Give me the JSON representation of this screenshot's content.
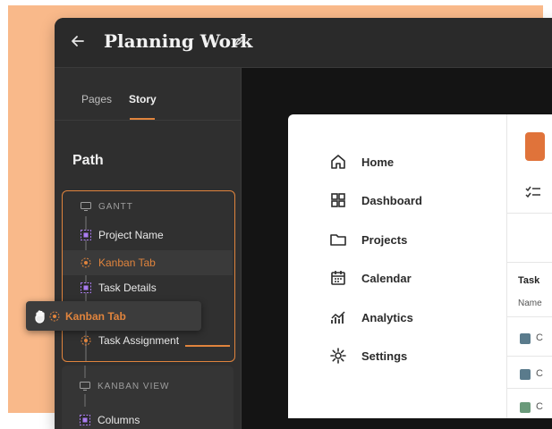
{
  "header": {
    "title": "Planning Work"
  },
  "sidebar": {
    "tabs": [
      {
        "label": "Pages"
      },
      {
        "label": "Story"
      }
    ],
    "path_title": "Path",
    "group1": {
      "header": "GANTT",
      "rows": [
        {
          "label": "Project Name"
        },
        {
          "label": "Kanban Tab"
        },
        {
          "label": "Task Details"
        },
        {
          "label": "Task Assignment"
        }
      ]
    },
    "group2": {
      "header": "KANBAN VIEW",
      "rows": [
        {
          "label": "Columns"
        }
      ]
    }
  },
  "drag_tooltip": {
    "label": "Kanban Tab"
  },
  "nav": {
    "items": [
      {
        "label": "Home",
        "icon": "home-icon"
      },
      {
        "label": "Dashboard",
        "icon": "dashboard-icon"
      },
      {
        "label": "Projects",
        "icon": "folder-icon"
      },
      {
        "label": "Calendar",
        "icon": "calendar-icon"
      },
      {
        "label": "Analytics",
        "icon": "analytics-icon"
      },
      {
        "label": "Settings",
        "icon": "settings-icon"
      }
    ]
  },
  "panel": {
    "task_header": "Task",
    "name_label": "Name",
    "row_marks": [
      "C",
      "C",
      "C"
    ],
    "colors": {
      "accent": "#e0843d",
      "swatch_blue": "#5a7b8c",
      "swatch_green": "#6a9a7a"
    }
  }
}
